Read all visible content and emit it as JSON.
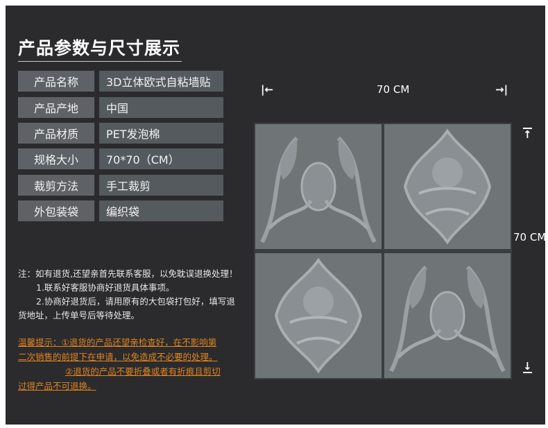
{
  "title": "产品参数与尺寸展示",
  "specs": [
    {
      "label": "产品名称",
      "value": "3D立体欧式自粘墙贴"
    },
    {
      "label": "产品产地",
      "value": "中国"
    },
    {
      "label": "产品材质",
      "value": "PET发泡棉"
    },
    {
      "label": "规格大小",
      "value": "70*70（CM）"
    },
    {
      "label": "裁剪方法",
      "value": "手工裁剪"
    },
    {
      "label": "外包装袋",
      "value": "编织袋"
    }
  ],
  "notes": {
    "line1": "注：如有退货,还望亲首先联系客服，以免耽误退换处理！",
    "line2": "1.联系好客服协商好退货具体事项。",
    "line3": "2.协商好退货后，请用原有的大包袋打包好，填写退",
    "line4": "货地址，上传单号后等待处理。"
  },
  "warning": {
    "line1": "温馨提示：①退货的产品还望亲检查好，在不影响第",
    "line2": "二次销售的前提下在申请，以免造成不必要的处理。",
    "line3": "②退货的产品不要折叠或者有折痕且剪切",
    "line4": "过得产品不可退换。"
  },
  "dimensions": {
    "width_label": "70 CM",
    "height_label": "70 CM"
  },
  "icons": {
    "left_arrow": "|←",
    "right_arrow": "→|",
    "up_arrow": "↑",
    "down_arrow": "↓"
  },
  "colors": {
    "background": "#2b2b2d",
    "label_bg": "#5e6266",
    "value_bg": "#555a5e",
    "warning": "#e0841f",
    "panel_gray": "#6f7477"
  }
}
